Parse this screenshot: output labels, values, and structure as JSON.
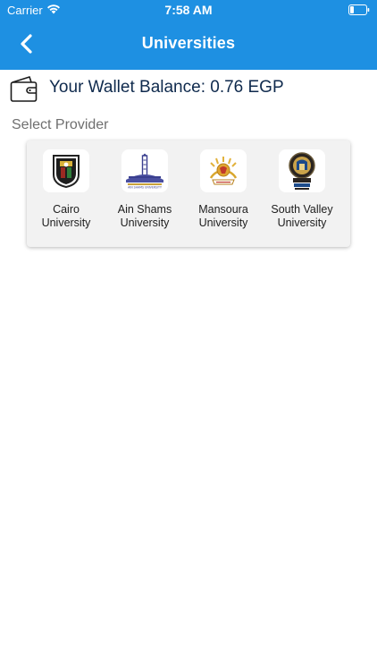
{
  "status_bar": {
    "carrier": "Carrier",
    "time": "7:58 AM"
  },
  "nav": {
    "title": "Universities",
    "back_icon": "chevron-left-icon"
  },
  "wallet": {
    "label": "Your Wallet Balance: 0.76 EGP",
    "icon": "wallet-icon"
  },
  "section": {
    "label": "Select Provider"
  },
  "providers": [
    {
      "name_line1": "Cairo",
      "name_line2": "University",
      "logo": "cairo-university-logo"
    },
    {
      "name_line1": "Ain Shams",
      "name_line2": "University",
      "logo": "ain-shams-university-logo"
    },
    {
      "name_line1": "Mansoura",
      "name_line2": "University",
      "logo": "mansoura-university-logo"
    },
    {
      "name_line1": "South Valley",
      "name_line2": "University",
      "logo": "south-valley-university-logo"
    }
  ],
  "colors": {
    "header": "#1e90e2",
    "header_text": "#ffffff",
    "card": "#f2f2f2",
    "wallet_text": "#0f2a4d"
  }
}
